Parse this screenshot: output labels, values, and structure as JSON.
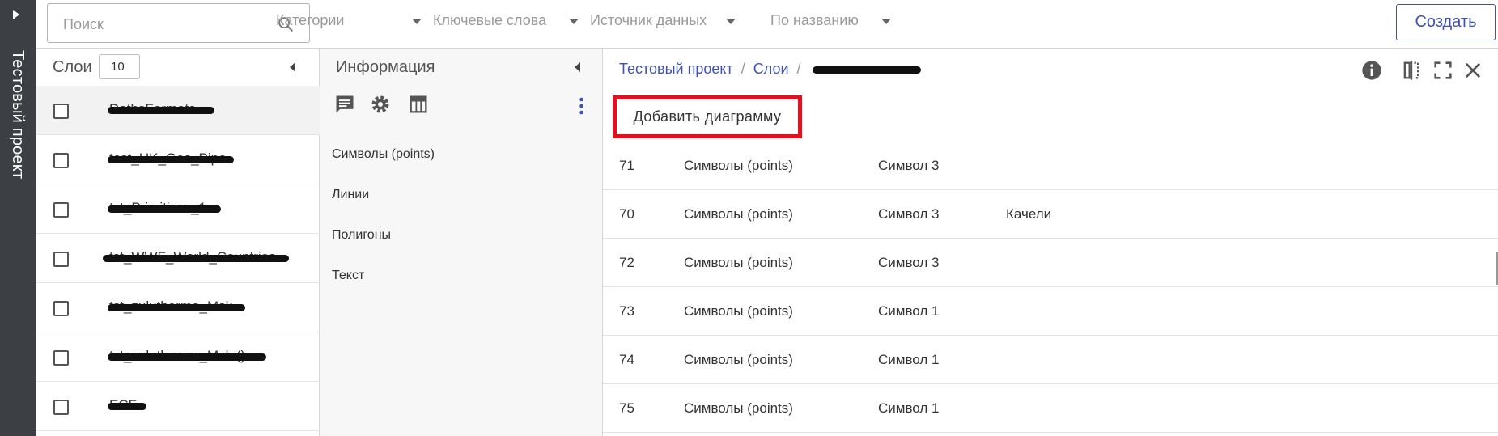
{
  "rail": {
    "title": "Тестовый проект"
  },
  "topbar": {
    "search_placeholder": "Поиск",
    "filters": [
      "Категории",
      "Ключевые слова",
      "Источник данных",
      "По названию"
    ],
    "create_label": "Создать"
  },
  "layers": {
    "label": "Слои",
    "count": "10",
    "items": [
      {
        "name": "DatbsFormats",
        "selected": true
      },
      {
        "name": "test_UK_Gas_Pipe",
        "selected": false
      },
      {
        "name": "tst_Primitives_1",
        "selected": false
      },
      {
        "name": "tst_WWF_World_Countries",
        "selected": false
      },
      {
        "name": "tst_zuluthermo_Msk",
        "selected": false
      },
      {
        "name": "tst_zuluthermo_Msk ()",
        "selected": false
      },
      {
        "name": "ECF",
        "selected": false
      }
    ]
  },
  "info": {
    "label": "Информация",
    "tools": [
      "comment-icon",
      "gear-icon",
      "table-icon"
    ],
    "items": [
      "Символы (points)",
      "Линии",
      "Полигоны",
      "Текст"
    ]
  },
  "detail": {
    "breadcrumb": [
      "Тестовый проект",
      "Слои"
    ],
    "add_chart_label": "Добавить диаграмму",
    "rows": [
      {
        "id": "71",
        "type": "Символы (points)",
        "symbol": "Символ 3",
        "extra": ""
      },
      {
        "id": "70",
        "type": "Символы (points)",
        "symbol": "Символ 3",
        "extra": "Качели"
      },
      {
        "id": "72",
        "type": "Символы (points)",
        "symbol": "Символ 3",
        "extra": ""
      },
      {
        "id": "73",
        "type": "Символы (points)",
        "symbol": "Символ 1",
        "extra": ""
      },
      {
        "id": "74",
        "type": "Символы (points)",
        "symbol": "Символ 1",
        "extra": ""
      },
      {
        "id": "75",
        "type": "Символы (points)",
        "symbol": "Символ 1",
        "extra": ""
      }
    ]
  },
  "colors": {
    "accent": "#3f51b5",
    "highlight": "#e3101e",
    "rail": "#3c3f44"
  }
}
